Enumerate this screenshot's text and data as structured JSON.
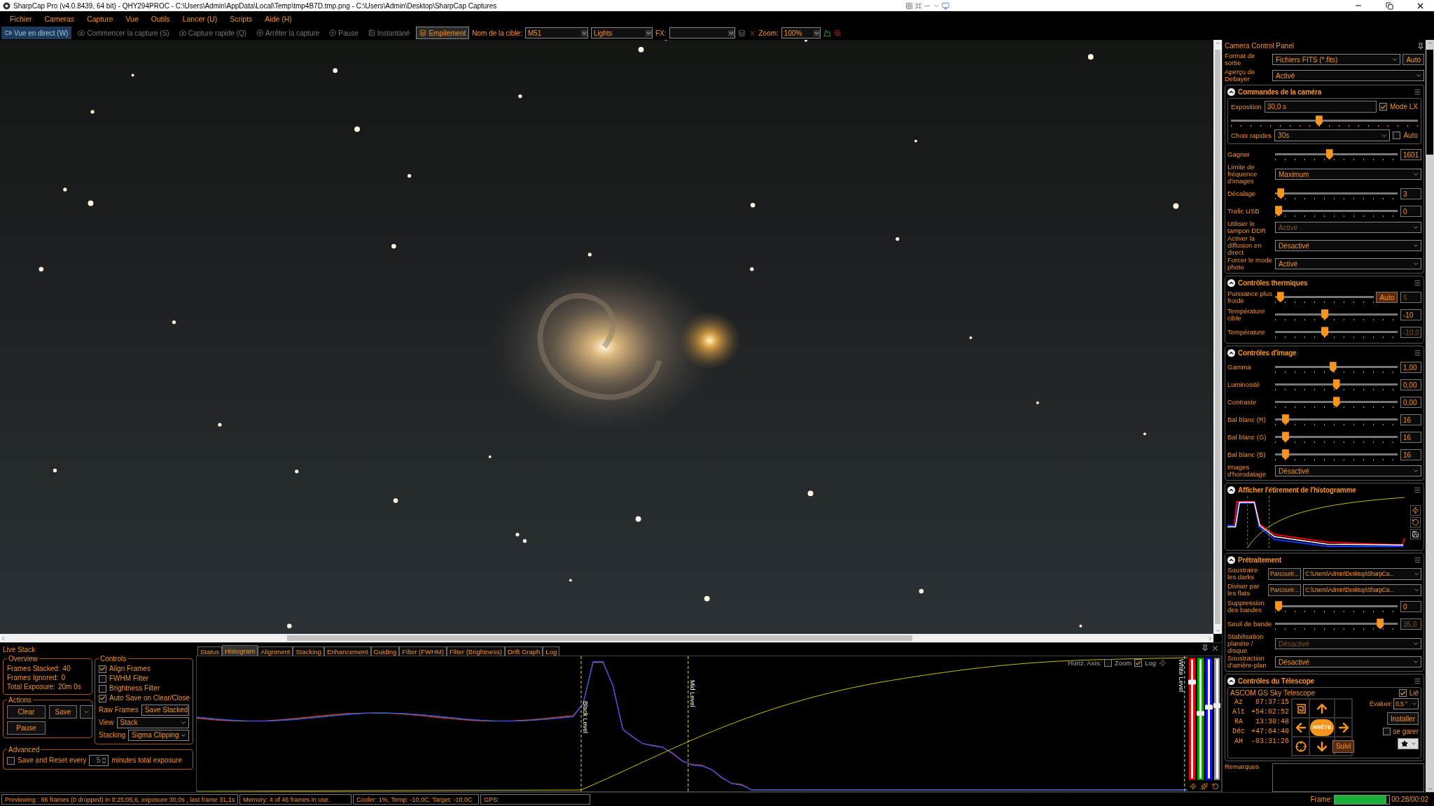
{
  "window": {
    "title": "SharpCap Pro (v4.0.8439, 64 bit) - QHY294PROC - C:\\Users\\Admin\\AppData\\Local\\Temp\\tmp4B7D.tmp.png - C:\\Users\\Admin\\Desktop\\SharpCap Captures"
  },
  "menu": [
    "Fichier",
    "Cameras",
    "Capture",
    "Vue",
    "Outils",
    "Lancer (U)",
    "Scripts",
    "Aide (H)"
  ],
  "toolbar": {
    "buttons": [
      {
        "label": "Vue en direct (W)",
        "selected": true,
        "disabled": false,
        "checked": false
      },
      {
        "label": "Commencer la capture (S)",
        "selected": false,
        "disabled": true,
        "checked": false
      },
      {
        "label": "Capture rapide (Q)",
        "selected": false,
        "disabled": true,
        "checked": false
      },
      {
        "label": "Arrêter la capture",
        "selected": false,
        "disabled": true,
        "checked": false
      },
      {
        "label": "Pause",
        "selected": false,
        "disabled": true,
        "checked": false
      },
      {
        "label": "Instantané",
        "selected": false,
        "disabled": true,
        "checked": false
      },
      {
        "label": "Empilement",
        "selected": false,
        "disabled": false,
        "checked": true
      }
    ],
    "target_label": "Nom de la cible:",
    "target_value": "M51",
    "frame_type": "Lights",
    "fx_label": "FX:",
    "zoom_label": "Zoom:",
    "zoom_value": "100%"
  },
  "right_panel": {
    "title": "Camera Control Panel",
    "top_rows": [
      {
        "kind": "select",
        "label": "Format de sortie",
        "value": "Fichiers FITS (*.fits)",
        "disabled": false,
        "button": "Auto"
      },
      {
        "kind": "select",
        "label": "Aperçu de Debayer",
        "value": "Activé",
        "disabled": false
      }
    ],
    "sections": [
      {
        "title": "Commandes de la caméra",
        "expanded": true,
        "rows": [
          {
            "kind": "exposure",
            "label": "Exposition",
            "value": "30,0 s",
            "check_label": "Mode LX",
            "checked": true,
            "level": 0.47,
            "quick_label": "Choix rapides",
            "quick_value": "30s",
            "auto_label": "Auto",
            "auto_checked": false
          },
          {
            "kind": "slider",
            "label": "Gagner",
            "level": 0.44,
            "value": "1601",
            "disabled": false
          },
          {
            "kind": "select",
            "label": "Limite de fréquence d'images",
            "value": "Maximum",
            "disabled": false
          },
          {
            "kind": "slider",
            "label": "Décalage",
            "level": 0.02,
            "value": "3",
            "disabled": false
          },
          {
            "kind": "slider",
            "label": "Trafic USB",
            "level": 0.0,
            "value": "0",
            "disabled": false
          },
          {
            "kind": "select",
            "label": "Utiliser le tampon DDR",
            "value": "Activé",
            "disabled": true
          },
          {
            "kind": "select",
            "label": "Activer la diffusion en direct",
            "value": "Désactivé",
            "disabled": false
          },
          {
            "kind": "select",
            "label": "Forcer le mode photo",
            "value": "Activé",
            "disabled": false
          }
        ]
      },
      {
        "title": "Contrôles thermiques",
        "expanded": true,
        "rows": [
          {
            "kind": "slider",
            "label": "Puissance plus froide",
            "level": 0.02,
            "value": "5",
            "disabled": true,
            "button": "Auto"
          },
          {
            "kind": "slider",
            "label": "Température cible",
            "level": 0.4,
            "value": "-10",
            "disabled": false
          },
          {
            "kind": "slider",
            "label": "Température",
            "level": 0.4,
            "value": "-10,0",
            "disabled": true
          }
        ]
      },
      {
        "title": "Contrôles d'image",
        "expanded": true,
        "rows": [
          {
            "kind": "slider",
            "label": "Gamma",
            "level": 0.47,
            "value": "1,00",
            "disabled": false
          },
          {
            "kind": "slider",
            "label": "Luminosité",
            "level": 0.5,
            "value": "0,00",
            "disabled": false
          },
          {
            "kind": "slider",
            "label": "Contraste",
            "level": 0.5,
            "value": "0,00",
            "disabled": false
          },
          {
            "kind": "slider",
            "label": "Bal blanc (R)",
            "level": 0.06,
            "value": "16",
            "disabled": false
          },
          {
            "kind": "slider",
            "label": "Bal blanc (G)",
            "level": 0.06,
            "value": "16",
            "disabled": false
          },
          {
            "kind": "slider",
            "label": "Bal blanc (B)",
            "level": 0.06,
            "value": "16",
            "disabled": false
          },
          {
            "kind": "select",
            "label": "Images d'horodatage",
            "value": "Désactivé",
            "disabled": false
          }
        ]
      },
      {
        "title": "Afficher l'étirement de l'histogramme",
        "expanded": true,
        "rows": [
          {
            "kind": "histogram"
          }
        ]
      },
      {
        "title": "Prétraitement",
        "expanded": true,
        "rows": [
          {
            "kind": "browse",
            "label": "Soustraire les darks",
            "button": "Parcourir...",
            "value": "C:\\Users\\Admin\\Desktop\\SharpCa..."
          },
          {
            "kind": "browse",
            "label": "Diviser par les flats",
            "button": "Parcourir...",
            "value": "C:\\Users\\Admin\\Desktop\\SharpCa..."
          },
          {
            "kind": "slider",
            "label": "Suppression des bandes",
            "level": 0.0,
            "value": "0",
            "disabled": false
          },
          {
            "kind": "slider",
            "label": "Seuil de bande",
            "level": 0.88,
            "value": "35,0",
            "disabled": true
          },
          {
            "kind": "select",
            "label": "Stabilisation planète / disque",
            "value": "Désactivé",
            "disabled": true
          },
          {
            "kind": "select",
            "label": "Soustraction d'arrière-plan",
            "value": "Désactivé",
            "disabled": false
          }
        ]
      },
      {
        "title": "Contrôles du Télescope",
        "expanded": true,
        "rows": [
          {
            "kind": "telescope",
            "name": "ASCOM GS Sky Telescope",
            "linked_label": "Lié",
            "linked": true,
            "coords": [
              {
                "label": "Az",
                "value": "67:37:15"
              },
              {
                "label": "Alt",
                "value": "+54:02:52"
              },
              {
                "label": "RA",
                "value": "13:30:48"
              },
              {
                "label": "Déc",
                "value": "+47:04:40"
              },
              {
                "label": "AH",
                "value": "-03:31:26"
              }
            ],
            "stop_label": "RRÊTE",
            "track_label": "Suivi",
            "rate_label": "Évaluer:",
            "rate_value": "0,5 °",
            "install_label": "Installer",
            "park_label": "se garer",
            "parked": false
          }
        ]
      }
    ],
    "notes_label": "Remarques"
  },
  "live_stack": {
    "title": "Live Stack",
    "overview": {
      "title": "Overview",
      "stats": [
        {
          "label": "Frames Stacked:",
          "value": "40"
        },
        {
          "label": "Frames Ignored:",
          "value": "0"
        },
        {
          "label": "Total Exposure:",
          "value": "20m 0s"
        }
      ]
    },
    "actions": {
      "title": "Actions",
      "clear": "Clear",
      "save": "Save",
      "pause": "Pause"
    },
    "controls": {
      "title": "Controls",
      "checks": [
        {
          "label": "Align Frames",
          "checked": true
        },
        {
          "label": "FWHM Filter",
          "checked": false
        },
        {
          "label": "Brightness Filter",
          "checked": false
        },
        {
          "label": "Auto Save on Clear/Close",
          "checked": true
        }
      ],
      "selects": [
        {
          "label": "Raw Frames",
          "value": "Save Stacked"
        },
        {
          "label": "View",
          "value": "Stack"
        },
        {
          "label": "Stacking",
          "value": "Sigma Clipping"
        }
      ]
    },
    "advanced": {
      "title": "Advanced",
      "check_label": "Save and Reset every",
      "checked": false,
      "spinner": "5",
      "suffix": "minutes total exposure"
    }
  },
  "histogram_panel": {
    "tabs": [
      {
        "label": "Status",
        "selected": false
      },
      {
        "label": "Histogram",
        "selected": true
      },
      {
        "label": "Alignment",
        "selected": false
      },
      {
        "label": "Stacking",
        "selected": false
      },
      {
        "label": "Enhancement",
        "selected": false
      },
      {
        "label": "Guiding",
        "selected": false
      },
      {
        "label": "Filter (FWHM)",
        "selected": false
      },
      {
        "label": "Filter (Brightness)",
        "selected": false
      },
      {
        "label": "Drift Graph",
        "selected": false
      },
      {
        "label": "Log",
        "selected": false
      }
    ],
    "axis_label": "Horiz. Axis:",
    "zoom": {
      "label": "Zoom",
      "checked": false
    },
    "log": {
      "label": "Log",
      "checked": true
    },
    "markers": [
      "Black Level",
      "Mid Level",
      "White Level"
    ]
  },
  "status_bar": {
    "segments": [
      "Previewing : 86 frames (0 dropped) in 0:25:05,6, exposure 30,0s , last frame 31,1s",
      "Memory: 4 of 46 frames in use.",
      "Cooler: 1%, Temp: -10,0C, Target: -10,0C",
      "GPS:"
    ],
    "frame_label": "Frame:",
    "progress": {
      "level": 0.95
    },
    "time": "00:28/00:02"
  }
}
